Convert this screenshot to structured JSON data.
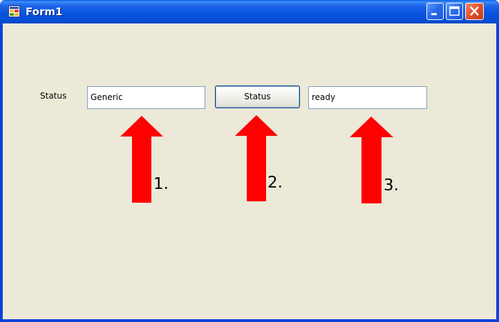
{
  "window": {
    "title": "Form1",
    "accent_color": "#0a43d8",
    "icon": "form-app-icon"
  },
  "title_buttons": {
    "minimize_icon": "minimize-icon",
    "maximize_icon": "maximize-icon",
    "close_icon": "close-icon"
  },
  "form": {
    "status_label": "Status",
    "input1_value": "Generic",
    "button_label": "Status",
    "input2_value": "ready"
  },
  "annotations": {
    "arrow_color": "#ff0000",
    "steps": [
      "1.",
      "2.",
      "3."
    ]
  }
}
